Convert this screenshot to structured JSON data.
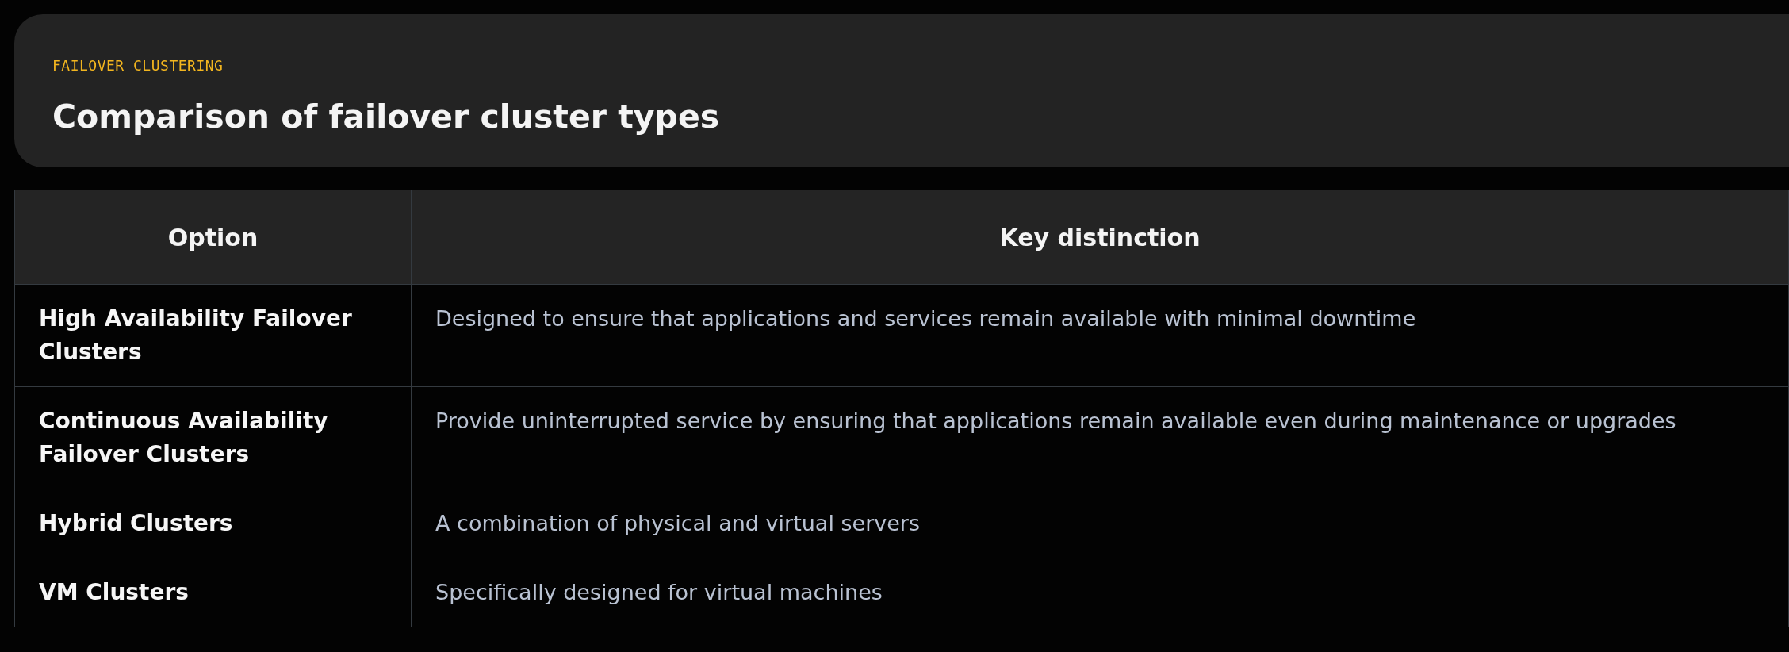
{
  "header": {
    "eyebrow": "FAILOVER CLUSTERING",
    "title": "Comparison of failover cluster types"
  },
  "table": {
    "columns": [
      "Option",
      "Key distinction"
    ],
    "rows": [
      {
        "option": "High Availability Failover Clusters",
        "distinction": "Designed to ensure that applications and services remain available with minimal downtime"
      },
      {
        "option": "Continuous Availability Failover Clusters",
        "distinction": "Provide uninterrupted service by ensuring that applications remain available even during maintenance or upgrades"
      },
      {
        "option": "Hybrid Clusters",
        "distinction": "A combination of physical and virtual servers"
      },
      {
        "option": "VM Clusters",
        "distinction": "Specifically designed for virtual machines"
      }
    ]
  }
}
